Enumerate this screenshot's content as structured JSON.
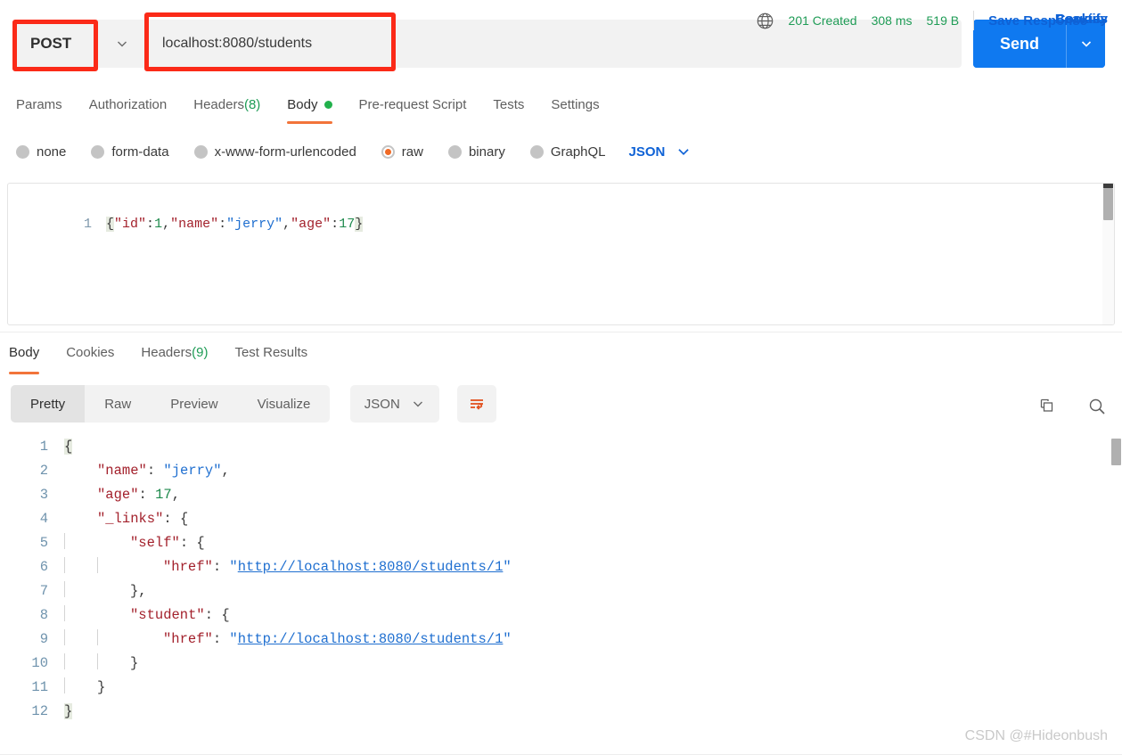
{
  "request": {
    "method": "POST",
    "url": "localhost:8080/students",
    "send_label": "Send",
    "tabs": [
      {
        "label": "Params",
        "active": false
      },
      {
        "label": "Authorization",
        "active": false
      },
      {
        "label": "Headers",
        "count": "(8)",
        "active": false
      },
      {
        "label": "Body",
        "active": true,
        "dot": true
      },
      {
        "label": "Pre-request Script",
        "active": false
      },
      {
        "label": "Tests",
        "active": false
      },
      {
        "label": "Settings",
        "active": false
      }
    ],
    "cookies_label": "Cookies",
    "body_types": [
      {
        "label": "none",
        "selected": false
      },
      {
        "label": "form-data",
        "selected": false
      },
      {
        "label": "x-www-form-urlencoded",
        "selected": false
      },
      {
        "label": "raw",
        "selected": true
      },
      {
        "label": "binary",
        "selected": false
      },
      {
        "label": "GraphQL",
        "selected": false
      }
    ],
    "raw_format": "JSON",
    "beautify_label": "Beautify",
    "body_line_number": "1",
    "body_raw": "{\"id\":1,\"name\":\"jerry\",\"age\":17}",
    "body_tokens": [
      {
        "t": "{",
        "c": "brace-hl"
      },
      {
        "t": "\"id\"",
        "c": "tok-key"
      },
      {
        "t": ":",
        "c": "tok-punc"
      },
      {
        "t": "1",
        "c": "tok-num"
      },
      {
        "t": ",",
        "c": "tok-punc"
      },
      {
        "t": "\"name\"",
        "c": "tok-key"
      },
      {
        "t": ":",
        "c": "tok-punc"
      },
      {
        "t": "\"jerry\"",
        "c": "tok-str"
      },
      {
        "t": ",",
        "c": "tok-punc"
      },
      {
        "t": "\"age\"",
        "c": "tok-key"
      },
      {
        "t": ":",
        "c": "tok-punc"
      },
      {
        "t": "17",
        "c": "tok-num"
      },
      {
        "t": "}",
        "c": "brace-hl"
      }
    ]
  },
  "response": {
    "tabs": [
      {
        "label": "Body",
        "active": true
      },
      {
        "label": "Cookies",
        "active": false
      },
      {
        "label": "Headers",
        "count": "(9)",
        "active": false
      },
      {
        "label": "Test Results",
        "active": false
      }
    ],
    "status": "201 Created",
    "time": "308 ms",
    "size": "519 B",
    "save_response_label": "Save Response",
    "format_tabs": [
      {
        "label": "Pretty",
        "active": true
      },
      {
        "label": "Raw",
        "active": false
      },
      {
        "label": "Preview",
        "active": false
      },
      {
        "label": "Visualize",
        "active": false
      }
    ],
    "format_type": "JSON",
    "icons": {
      "globe": "globe-icon",
      "wrap": "word-wrap-icon",
      "copy": "copy-icon",
      "search": "search-icon"
    },
    "body_lines": [
      {
        "n": "1",
        "indent": 0,
        "guides": 0,
        "tokens": [
          {
            "t": "{",
            "c": "brace-hl"
          }
        ]
      },
      {
        "n": "2",
        "indent": 1,
        "guides": 0,
        "tokens": [
          {
            "t": "\"name\"",
            "c": "tok-key"
          },
          {
            "t": ": ",
            "c": "tok-punc"
          },
          {
            "t": "\"jerry\"",
            "c": "tok-str"
          },
          {
            "t": ",",
            "c": "tok-punc"
          }
        ]
      },
      {
        "n": "3",
        "indent": 1,
        "guides": 0,
        "tokens": [
          {
            "t": "\"age\"",
            "c": "tok-key"
          },
          {
            "t": ": ",
            "c": "tok-punc"
          },
          {
            "t": "17",
            "c": "tok-num"
          },
          {
            "t": ",",
            "c": "tok-punc"
          }
        ]
      },
      {
        "n": "4",
        "indent": 1,
        "guides": 0,
        "tokens": [
          {
            "t": "\"_links\"",
            "c": "tok-key"
          },
          {
            "t": ": {",
            "c": "tok-punc"
          }
        ]
      },
      {
        "n": "5",
        "indent": 2,
        "guides": 1,
        "tokens": [
          {
            "t": "\"self\"",
            "c": "tok-key"
          },
          {
            "t": ": {",
            "c": "tok-punc"
          }
        ]
      },
      {
        "n": "6",
        "indent": 3,
        "guides": 2,
        "tokens": [
          {
            "t": "\"href\"",
            "c": "tok-key"
          },
          {
            "t": ": ",
            "c": "tok-punc"
          },
          {
            "t": "\"",
            "c": "tok-str"
          },
          {
            "t": "http://localhost:8080/students/1",
            "c": "tok-link"
          },
          {
            "t": "\"",
            "c": "tok-str"
          }
        ]
      },
      {
        "n": "7",
        "indent": 2,
        "guides": 1,
        "tokens": [
          {
            "t": "},",
            "c": "tok-punc"
          }
        ]
      },
      {
        "n": "8",
        "indent": 2,
        "guides": 1,
        "tokens": [
          {
            "t": "\"student\"",
            "c": "tok-key"
          },
          {
            "t": ": {",
            "c": "tok-punc"
          }
        ]
      },
      {
        "n": "9",
        "indent": 3,
        "guides": 2,
        "tokens": [
          {
            "t": "\"href\"",
            "c": "tok-key"
          },
          {
            "t": ": ",
            "c": "tok-punc"
          },
          {
            "t": "\"",
            "c": "tok-str"
          },
          {
            "t": "http://localhost:8080/students/1",
            "c": "tok-link"
          },
          {
            "t": "\"",
            "c": "tok-str"
          }
        ]
      },
      {
        "n": "10",
        "indent": 2,
        "guides": 2,
        "tokens": [
          {
            "t": "}",
            "c": "tok-punc"
          }
        ]
      },
      {
        "n": "11",
        "indent": 1,
        "guides": 1,
        "tokens": [
          {
            "t": "}",
            "c": "tok-punc"
          }
        ]
      },
      {
        "n": "12",
        "indent": 0,
        "guides": 0,
        "tokens": [
          {
            "t": "}",
            "c": "brace-hl"
          }
        ]
      }
    ]
  },
  "watermark": "CSDN @#Hideonbush",
  "colors": {
    "accent_blue": "#0f79f0",
    "link_blue": "#0f62d6",
    "active_orange": "#f2743a",
    "status_green": "#1f9c56",
    "radio_orange": "#f06a25"
  }
}
